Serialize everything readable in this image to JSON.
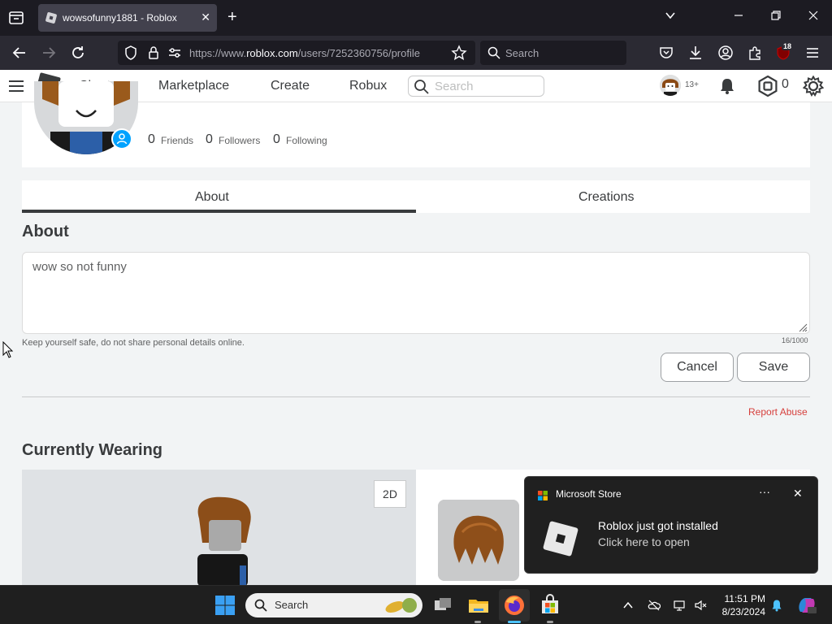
{
  "browser": {
    "tab_title": "wowsofunny1881 - Roblox",
    "tab_close": "✕",
    "new_tab": "+",
    "url_prefix": "https://www.",
    "url_domain": "roblox.com",
    "url_path": "/users/7252360756/profile",
    "search_placeholder": "Search",
    "extension_badge": "18"
  },
  "header": {
    "nav": [
      "Charts",
      "Marketplace",
      "Create",
      "Robux"
    ],
    "search_placeholder": "Search",
    "age_label": "13+",
    "robux": "0"
  },
  "profile": {
    "stats": [
      {
        "value": "0",
        "label": "Friends"
      },
      {
        "value": "0",
        "label": "Followers"
      },
      {
        "value": "0",
        "label": "Following"
      }
    ]
  },
  "tabs": {
    "about": "About",
    "creations": "Creations"
  },
  "about": {
    "title": "About",
    "text": "wow so not funny",
    "hint": "Keep yourself safe, do not share personal details online.",
    "char_count": "16/1000",
    "cancel": "Cancel",
    "save": "Save",
    "report": "Report Abuse"
  },
  "wearing": {
    "title": "Currently Wearing",
    "toggle_2d": "2D"
  },
  "toast": {
    "app_name": "Microsoft Store",
    "more": "···",
    "close": "✕",
    "line1": "Roblox just got installed",
    "line2": "Click here to open"
  },
  "taskbar": {
    "search_placeholder": "Search",
    "time": "11:51 PM",
    "date": "8/23/2024"
  },
  "colors": {
    "browser_dark": "#1c1b22",
    "roblox_text": "#393b3d",
    "report_red": "#d63f3c",
    "online_blue": "#00a2ff"
  }
}
